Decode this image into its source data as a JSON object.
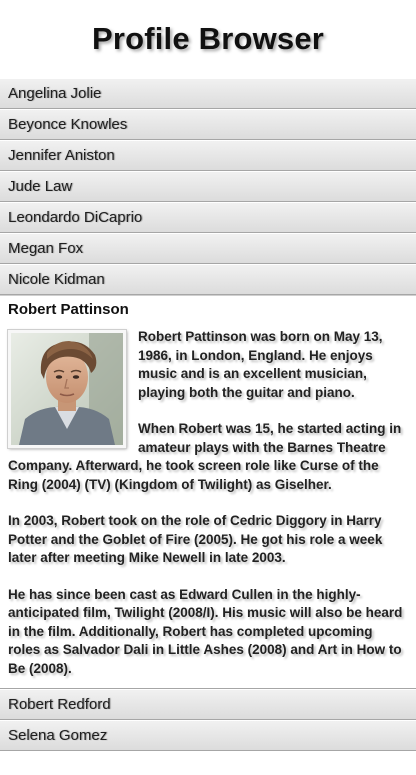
{
  "header": {
    "title": "Profile Browser"
  },
  "profiles_before": [
    {
      "name": "Angelina Jolie"
    },
    {
      "name": "Beyonce Knowles"
    },
    {
      "name": "Jennifer Aniston"
    },
    {
      "name": "Jude Law"
    },
    {
      "name": "Leondardo DiCaprio"
    },
    {
      "name": "Megan Fox"
    },
    {
      "name": "Nicole Kidman"
    }
  ],
  "expanded": {
    "name": "Robert Pattinson",
    "paragraphs": [
      "Robert Pattinson was born on May 13, 1986, in London, England. He enjoys music and is an excellent musician, playing both the guitar and piano.",
      "When Robert was 15, he started acting in amateur plays with the Barnes Theatre Company. Afterward, he took screen role like Curse of the Ring (2004) (TV) (Kingdom of Twilight) as Giselher.",
      "In 2003, Robert took on the role of Cedric Diggory in Harry Potter and the Goblet of Fire (2005). He got his role a week later after meeting Mike Newell in late 2003.",
      "He has since been cast as Edward Cullen in the highly-anticipated film, Twilight (2008/I). His music will also be heard in the film. Additionally, Robert has completed upcoming roles as Salvador Dali in Little Ashes (2008) and Art in How to Be (2008)."
    ]
  },
  "profiles_after": [
    {
      "name": "Robert Redford"
    },
    {
      "name": "Selena Gomez"
    }
  ]
}
